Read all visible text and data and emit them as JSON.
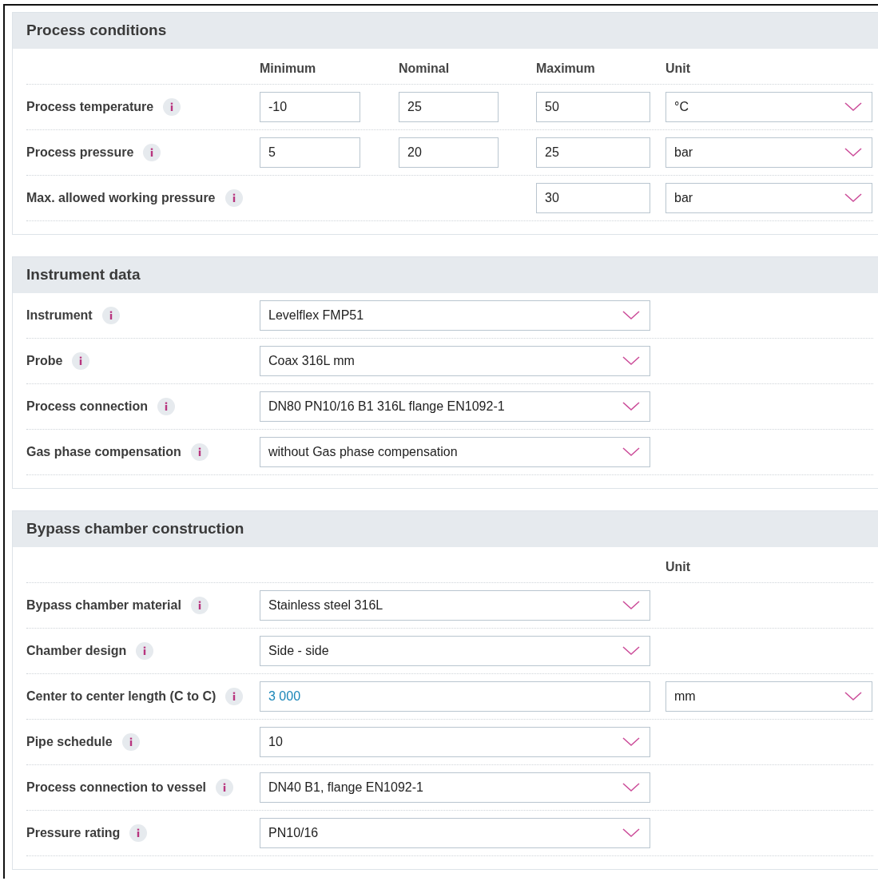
{
  "sections": [
    {
      "title": "Process conditions",
      "header": {
        "minimum": "Minimum",
        "nominal": "Nominal",
        "maximum": "Maximum",
        "unit": "Unit"
      },
      "rows": [
        {
          "kind": "range",
          "label": "Process temperature",
          "minimum": "-10",
          "nominal": "25",
          "maximum": "50",
          "unit": "°C"
        },
        {
          "kind": "range",
          "label": "Process pressure",
          "minimum": "5",
          "nominal": "20",
          "maximum": "25",
          "unit": "bar"
        },
        {
          "kind": "max_unit",
          "label": "Max. allowed working pressure",
          "maximum": "30",
          "unit": "bar"
        }
      ]
    },
    {
      "title": "Instrument data",
      "rows": [
        {
          "kind": "select",
          "label": "Instrument",
          "value": "Levelflex FMP51"
        },
        {
          "kind": "select",
          "label": "Probe",
          "value": "Coax 316L mm"
        },
        {
          "kind": "select",
          "label": "Process connection",
          "value": "DN80 PN10/16 B1 316L flange EN1092-1"
        },
        {
          "kind": "select",
          "label": "Gas phase compensation",
          "value": "without Gas phase compensation"
        }
      ]
    },
    {
      "title": "Bypass chamber construction",
      "header": {
        "unit": "Unit"
      },
      "rows": [
        {
          "kind": "select",
          "label": "Bypass chamber material",
          "value": "Stainless steel 316L"
        },
        {
          "kind": "select",
          "label": "Chamber design",
          "value": "Side - side"
        },
        {
          "kind": "input_unit",
          "label": "Center to center length (C to C)",
          "value": "3 000",
          "unit": "mm"
        },
        {
          "kind": "select",
          "label": "Pipe schedule",
          "value": "10"
        },
        {
          "kind": "select",
          "label": "Process connection to vessel",
          "value": "DN40 B1, flange EN1092-1"
        },
        {
          "kind": "select",
          "label": "Pressure rating",
          "value": "PN10/16"
        }
      ]
    }
  ]
}
